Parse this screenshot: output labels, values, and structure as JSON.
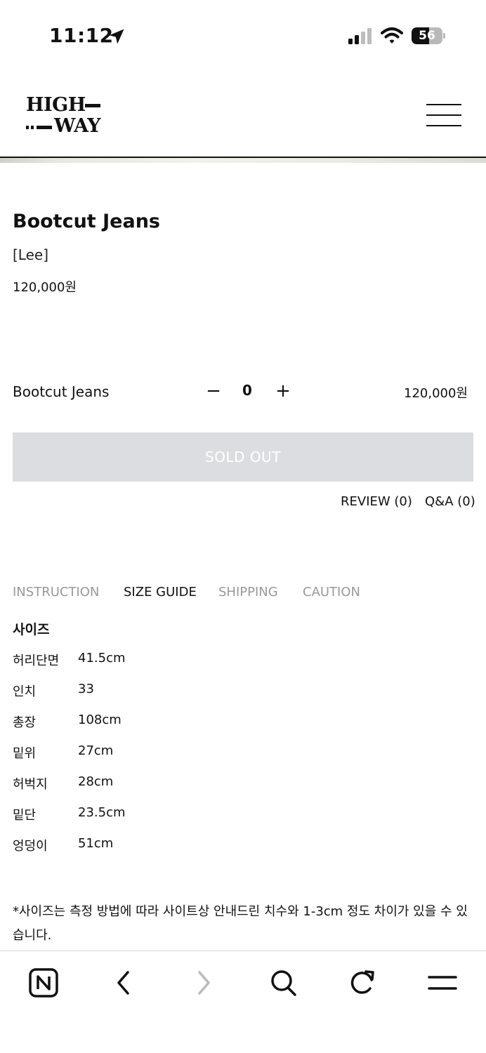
{
  "status_bar": {
    "time": "11:12",
    "battery_level": "56",
    "battery_percent": 56,
    "icons": [
      "location-arrow-icon",
      "cellular-signal-icon",
      "wifi-icon",
      "battery-icon"
    ]
  },
  "header": {
    "logo_line1": "HIGH",
    "logo_line2": "WAY",
    "menu_icon": "hamburger-menu-icon"
  },
  "product": {
    "title": "Bootcut Jeans",
    "brand": "[Lee]",
    "price": "120,000원"
  },
  "option": {
    "name": "Bootcut Jeans",
    "minus_label": "−",
    "quantity": "0",
    "plus_label": "+",
    "price": "120,000원"
  },
  "buy_button": {
    "label": "SOLD OUT"
  },
  "links": {
    "review": "REVIEW (0)",
    "qa": "Q&A (0)"
  },
  "tabs": [
    {
      "label": "INSTRUCTION",
      "active": false
    },
    {
      "label": "SIZE GUIDE",
      "active": true
    },
    {
      "label": "SHIPPING",
      "active": false
    },
    {
      "label": "CAUTION",
      "active": false
    }
  ],
  "size_guide": {
    "heading": "사이즈",
    "rows": [
      {
        "label": "허리단면",
        "value": "41.5cm"
      },
      {
        "label": "인치",
        "value": "33"
      },
      {
        "label": "총장",
        "value": "108cm"
      },
      {
        "label": "밑위",
        "value": "27cm"
      },
      {
        "label": "허벅지",
        "value": "28cm"
      },
      {
        "label": "밑단",
        "value": "23.5cm"
      },
      {
        "label": "엉덩이",
        "value": "51cm"
      }
    ],
    "note": "*사이즈는 측정 방법에 따라 사이트상 안내드린 치수와 1-3cm 정도 차이가 있을 수 있습니다."
  },
  "toolbar": {
    "icons": [
      "naver-home-icon",
      "back-chevron-icon",
      "forward-chevron-icon",
      "search-icon",
      "refresh-icon",
      "menu-icon"
    ]
  },
  "colors": {
    "soldout_bg": "#dcdde0",
    "inactive_tab": "#999999",
    "text": "#111111"
  }
}
